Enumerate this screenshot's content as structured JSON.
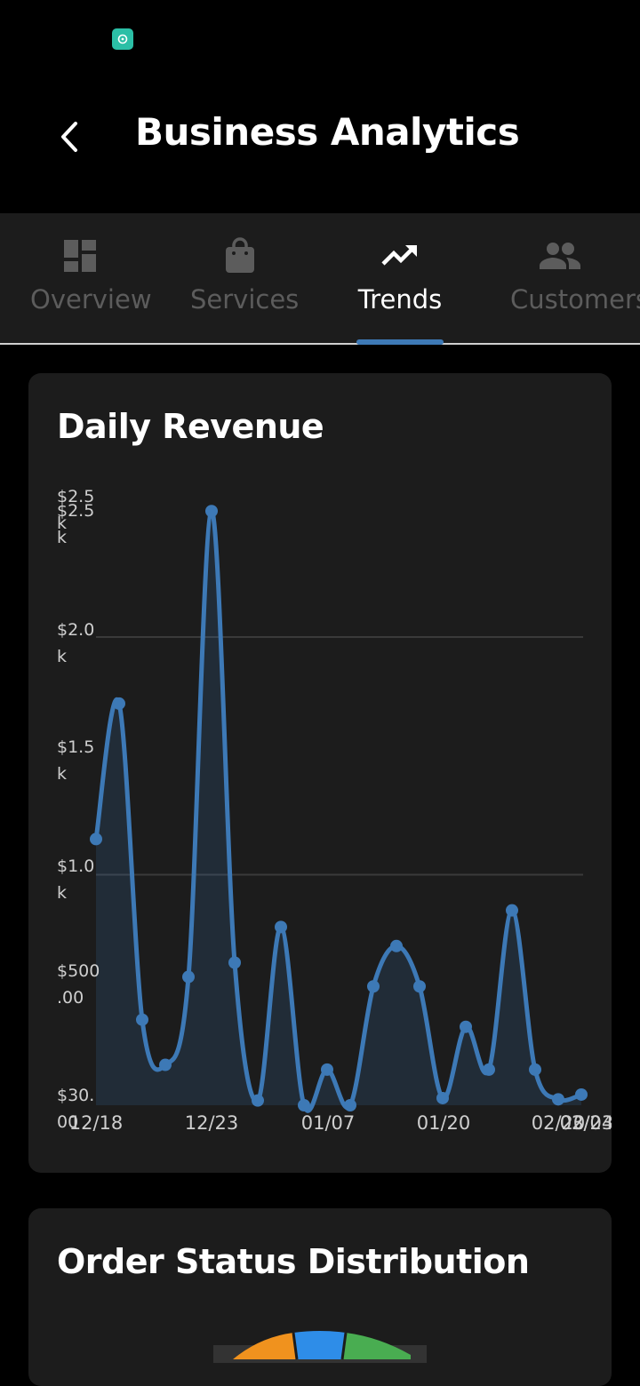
{
  "app": {
    "title": "Business Analytics"
  },
  "status_bar": {
    "icon": "app-notification-icon",
    "icon_color": "#2bbfa6"
  },
  "tabs": [
    {
      "label": "Overview",
      "icon": "dashboard-icon",
      "active": false
    },
    {
      "label": "Services",
      "icon": "shopping-bag-icon",
      "active": false
    },
    {
      "label": "Trends",
      "icon": "trending-up-icon",
      "active": true
    },
    {
      "label": "Customers",
      "icon": "people-icon",
      "active": false
    }
  ],
  "colors": {
    "accent": "#3d79b6",
    "card": "#1c1c1c",
    "inactive_text": "#5c5c5c",
    "pie_orange": "#f0921e",
    "pie_blue": "#2e8de8",
    "pie_green": "#49ad51"
  },
  "cards": {
    "revenue": {
      "title": "Daily Revenue"
    },
    "orders": {
      "title": "Order Status Distribution"
    }
  },
  "chart_data": {
    "type": "area",
    "title": "Daily Revenue",
    "xlabel": "",
    "ylabel": "",
    "y_tick_labels": [
      {
        "value": 2500,
        "label": "$2.5k"
      },
      {
        "value": 2500,
        "label": "$2.5k"
      },
      {
        "value": 2000,
        "label": "$2.0k"
      },
      {
        "value": 1500,
        "label": "$1.5k"
      },
      {
        "value": 1000,
        "label": "$1.0k"
      },
      {
        "value": 500,
        "label": "$500.00"
      },
      {
        "value": 30,
        "label": "$30.00"
      }
    ],
    "x_tick_labels": [
      {
        "index": 0,
        "label": "12/18"
      },
      {
        "index": 5,
        "label": "12/23"
      },
      {
        "index": 10,
        "label": "01/07"
      },
      {
        "index": 15,
        "label": "01/20"
      },
      {
        "index": 20,
        "label": "02/20"
      },
      {
        "index": 21,
        "label": "02/24"
      },
      {
        "index": 21,
        "label": "03/03"
      }
    ],
    "ylim": [
      30,
      2600
    ],
    "grid": true,
    "gridlines": [
      2000,
      1000
    ],
    "points": [
      {
        "index": 0,
        "value": 1150
      },
      {
        "index": 1,
        "value": 1720
      },
      {
        "index": 2,
        "value": 390
      },
      {
        "index": 3,
        "value": 200
      },
      {
        "index": 4,
        "value": 570
      },
      {
        "index": 5,
        "value": 2530
      },
      {
        "index": 6,
        "value": 630
      },
      {
        "index": 7,
        "value": 50
      },
      {
        "index": 8,
        "value": 780
      },
      {
        "index": 9,
        "value": 30
      },
      {
        "index": 10,
        "value": 180
      },
      {
        "index": 11,
        "value": 30
      },
      {
        "index": 12,
        "value": 530
      },
      {
        "index": 13,
        "value": 700
      },
      {
        "index": 14,
        "value": 530
      },
      {
        "index": 15,
        "value": 60
      },
      {
        "index": 16,
        "value": 360
      },
      {
        "index": 17,
        "value": 180
      },
      {
        "index": 18,
        "value": 850
      },
      {
        "index": 19,
        "value": 180
      },
      {
        "index": 20,
        "value": 55
      },
      {
        "index": 21,
        "value": 75
      }
    ]
  }
}
